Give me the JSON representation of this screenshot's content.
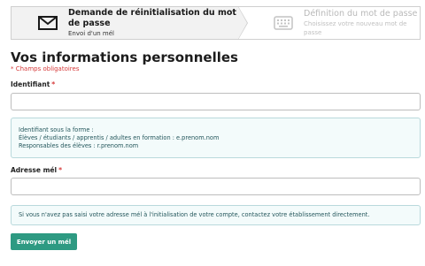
{
  "wizard": {
    "step1": {
      "title": "Demande de réinitialisation du mot de passe",
      "subtitle": "Envoi d'un mél",
      "icon": "envelope-icon"
    },
    "step2": {
      "title": "Définition du mot de passe",
      "subtitle": "Choisissez votre nouveau mot de passe",
      "icon": "keyboard-icon"
    }
  },
  "form": {
    "title": "Vos informations personnelles",
    "required_note": "* Champs obligatoires",
    "identifier_label": "Identifiant",
    "identifier_value": "",
    "identifier_hint": {
      "line1": "Identifiant sous la forme :",
      "line2": "Élèves / étudiants / apprentis / adultes en formation : e.prenom.nom",
      "line3": "Responsables des élèves : r.prenom.nom"
    },
    "email_label": "Adresse mél",
    "email_value": "",
    "email_hint": "Si vous n'avez pas saisi votre adresse mél à l'initialisation de votre compte, contactez votre établissement directement.",
    "submit_label": "Envoyer un mél",
    "required_marker": "*"
  },
  "colors": {
    "accent": "#2e9a82",
    "required": "#d63b3b",
    "hint_bg": "#f3fbfb",
    "hint_border": "#b9d9dc"
  }
}
